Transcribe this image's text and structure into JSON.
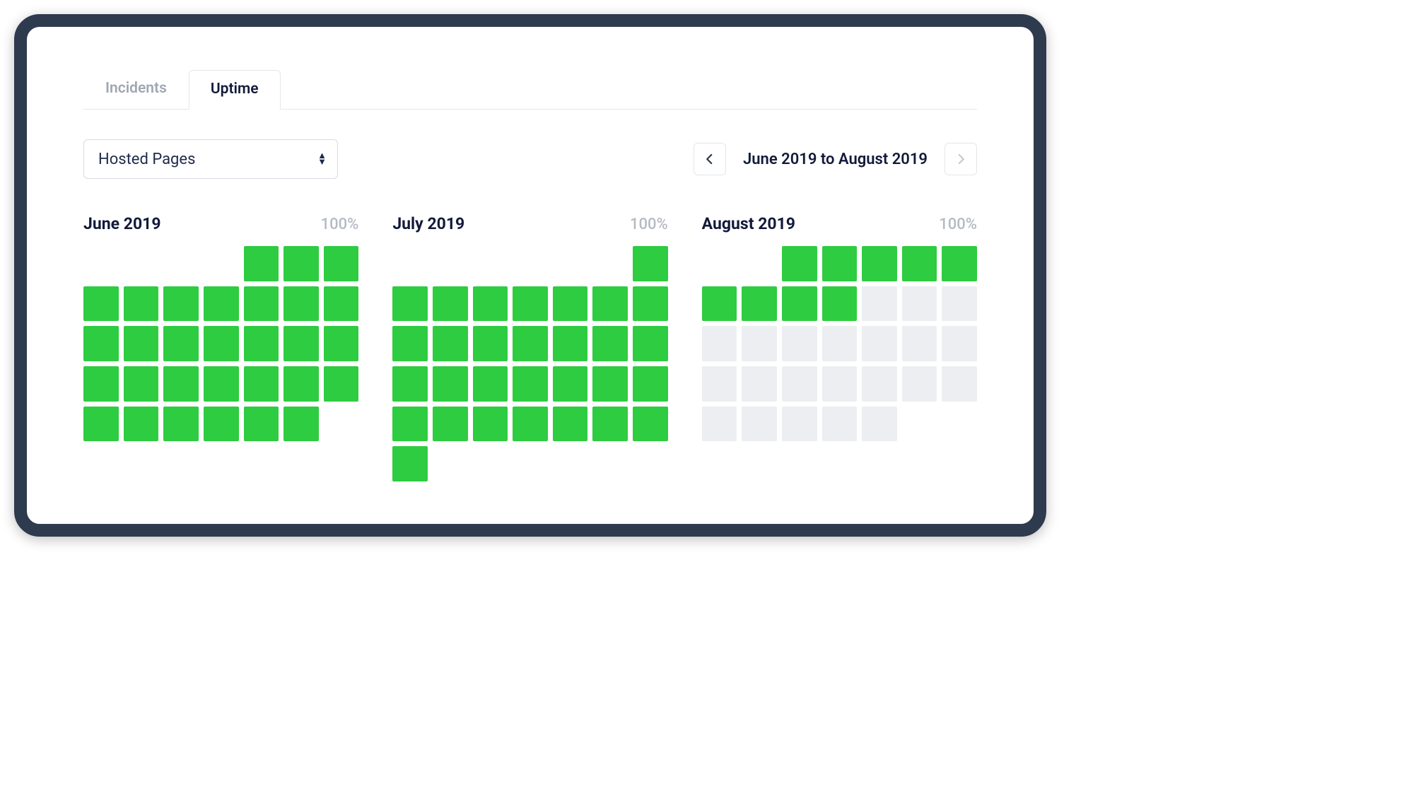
{
  "tabs": [
    {
      "label": "Incidents",
      "active": false
    },
    {
      "label": "Uptime",
      "active": true
    }
  ],
  "filter": {
    "selected": "Hosted Pages"
  },
  "range": {
    "label": "June 2019 to August 2019"
  },
  "colors": {
    "up": "#2ecc40",
    "future": "#eceef1"
  },
  "months": [
    {
      "name": "June 2019",
      "uptime": "100%",
      "startOffset": 4,
      "days": 30,
      "status": [
        "up",
        "up",
        "up",
        "up",
        "up",
        "up",
        "up",
        "up",
        "up",
        "up",
        "up",
        "up",
        "up",
        "up",
        "up",
        "up",
        "up",
        "up",
        "up",
        "up",
        "up",
        "up",
        "up",
        "up",
        "up",
        "up",
        "up",
        "up",
        "up",
        "up"
      ]
    },
    {
      "name": "July 2019",
      "uptime": "100%",
      "startOffset": 6,
      "days": 30,
      "status": [
        "up",
        "up",
        "up",
        "up",
        "up",
        "up",
        "up",
        "up",
        "up",
        "up",
        "up",
        "up",
        "up",
        "up",
        "up",
        "up",
        "up",
        "up",
        "up",
        "up",
        "up",
        "up",
        "up",
        "up",
        "up",
        "up",
        "up",
        "up",
        "up",
        "up"
      ]
    },
    {
      "name": "August 2019",
      "uptime": "100%",
      "startOffset": 2,
      "days": 31,
      "status": [
        "up",
        "up",
        "up",
        "up",
        "up",
        "up",
        "up",
        "up",
        "up",
        "future",
        "future",
        "future",
        "future",
        "future",
        "future",
        "future",
        "future",
        "future",
        "future",
        "future",
        "future",
        "future",
        "future",
        "future",
        "future",
        "future",
        "future",
        "future",
        "future",
        "future",
        "future"
      ]
    }
  ]
}
